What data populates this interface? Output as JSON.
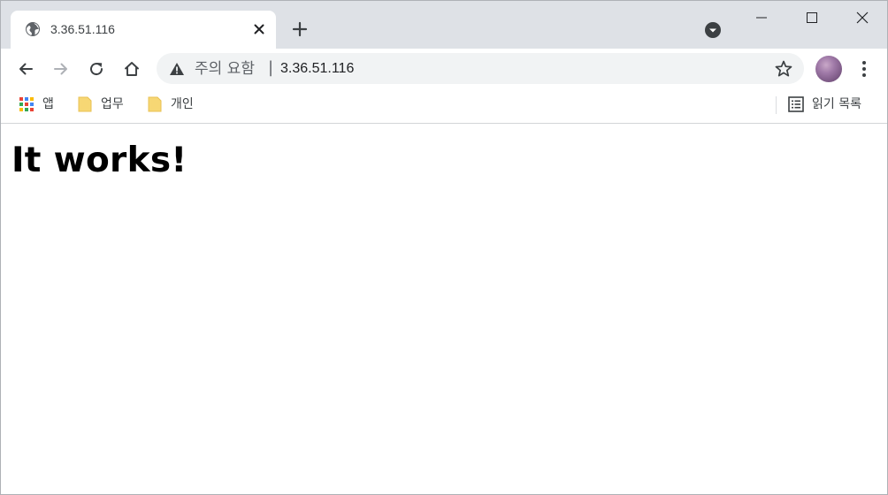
{
  "window": {
    "controls": {
      "minimize": "minimize",
      "maximize": "maximize",
      "close": "close"
    }
  },
  "tab": {
    "title": "3.36.51.116",
    "favicon": "globe-icon"
  },
  "toolbar": {
    "security_label": "주의 요함",
    "separator": "|",
    "url": "3.36.51.116"
  },
  "bookmarks": {
    "apps_label": "앱",
    "work_label": "업무",
    "personal_label": "개인",
    "reading_list_label": "읽기 목록"
  },
  "page": {
    "heading": "It works!"
  },
  "colors": {
    "titlebar": "#dee1e6",
    "omnibox": "#f1f3f4",
    "folder": "#f7d774"
  }
}
